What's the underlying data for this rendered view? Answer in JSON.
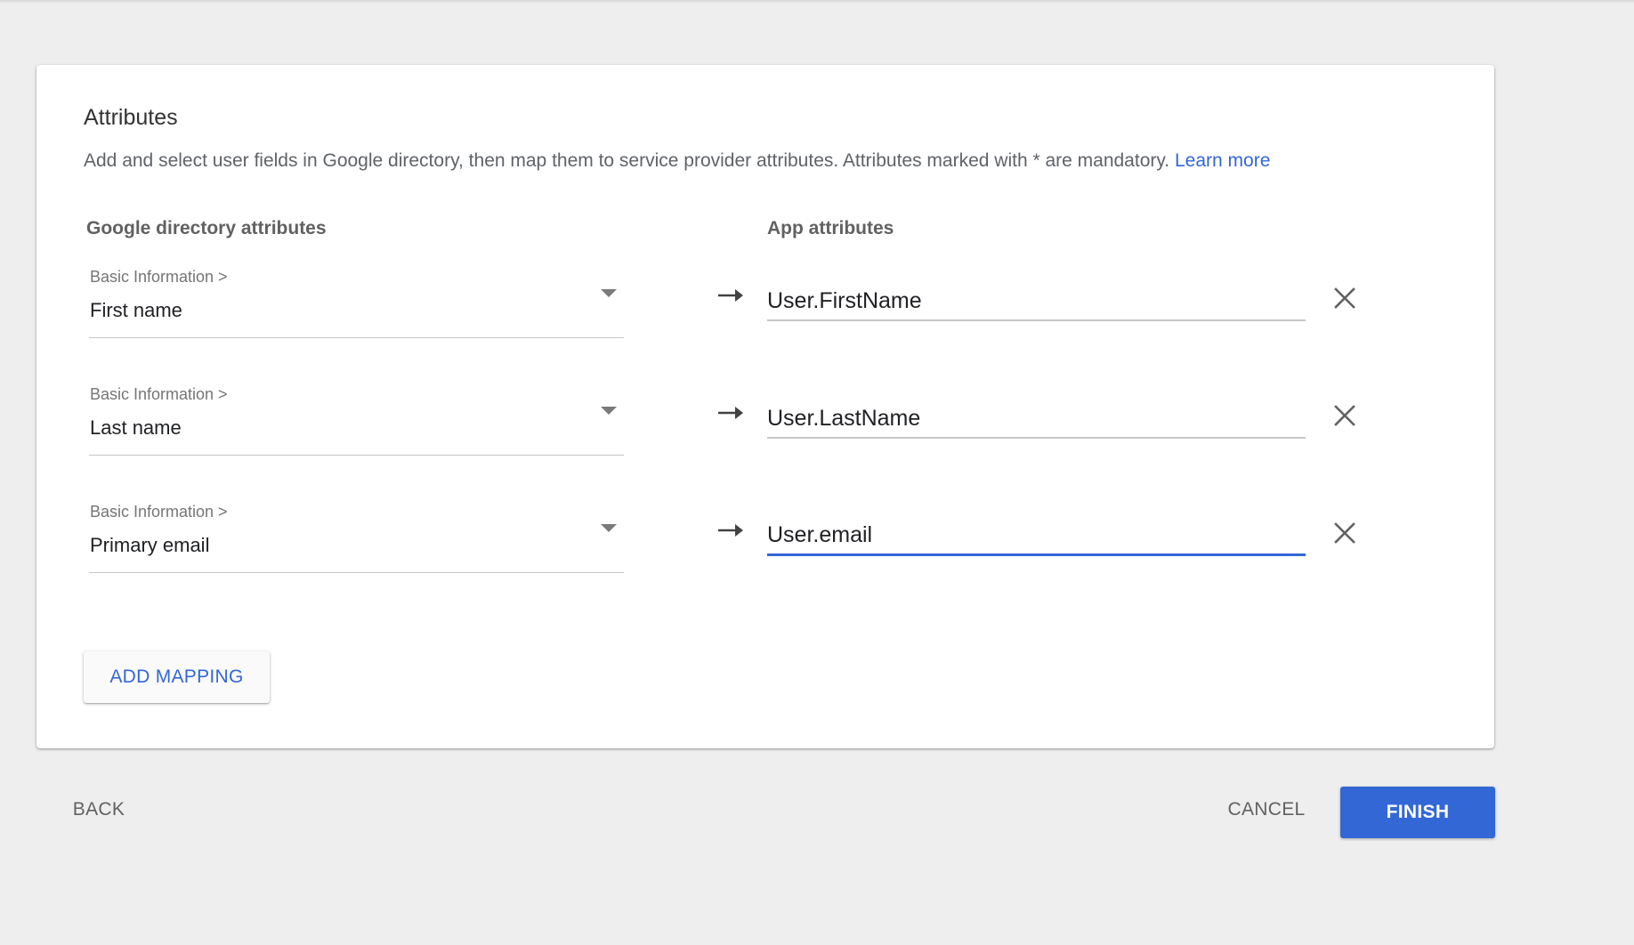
{
  "attributes": {
    "title": "Attributes",
    "description": "Add and select user fields in Google directory, then map them to service provider attributes. Attributes marked with * are mandatory.",
    "learn_more": "Learn more",
    "google_header": "Google directory attributes",
    "app_header": "App attributes"
  },
  "mappings": [
    {
      "category": "Basic Information >",
      "field": "First name",
      "app_value": "User.FirstName",
      "focused": false
    },
    {
      "category": "Basic Information >",
      "field": "Last name",
      "app_value": "User.LastName",
      "focused": false
    },
    {
      "category": "Basic Information >",
      "field": "Primary email",
      "app_value": "User.email",
      "focused": true
    }
  ],
  "actions": {
    "add_mapping": "ADD MAPPING",
    "back": "BACK",
    "cancel": "CANCEL",
    "finish": "FINISH"
  },
  "colors": {
    "accent": "#3367d6",
    "background": "#eeeeee",
    "card": "#ffffff"
  },
  "icons": {
    "dropdown": "caret-down-icon",
    "mapping": "arrow-right-icon",
    "remove": "close-icon"
  }
}
